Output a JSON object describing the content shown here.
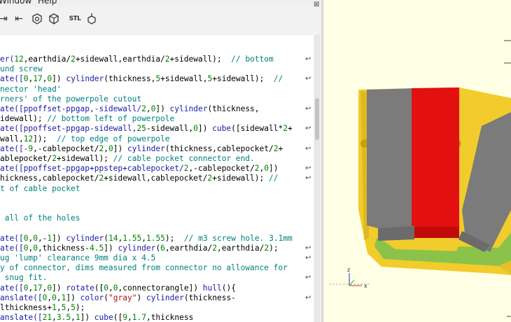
{
  "menu": {
    "window": "Window",
    "help": "Help"
  },
  "toolbar": {
    "stl_label": "STL",
    "close": "⊠"
  },
  "editor": {
    "lines": [
      [
        {
          "t": "er(",
          "c": "kw"
        },
        {
          "t": "12",
          "c": "num"
        },
        {
          "t": ",earthdia/",
          "c": ""
        },
        {
          "t": "2",
          "c": "num"
        },
        {
          "t": "+sidewall,earthdia/",
          "c": ""
        },
        {
          "t": "2",
          "c": "num"
        },
        {
          "t": "+sidewall);  ",
          "c": ""
        },
        {
          "t": "// bottom",
          "c": "cm"
        }
      ],
      [
        {
          "t": "und screw",
          "c": "cm"
        }
      ],
      [
        {
          "t": "ate([",
          "c": "kw"
        },
        {
          "t": "0",
          "c": "num"
        },
        {
          "t": ",",
          "c": ""
        },
        {
          "t": "17",
          "c": "num"
        },
        {
          "t": ",",
          "c": ""
        },
        {
          "t": "0",
          "c": "num"
        },
        {
          "t": "]) ",
          "c": ""
        },
        {
          "t": "cylinder",
          "c": "kw"
        },
        {
          "t": "(thickness,",
          "c": ""
        },
        {
          "t": "5",
          "c": "num"
        },
        {
          "t": "+sidewall,",
          "c": ""
        },
        {
          "t": "5",
          "c": "num"
        },
        {
          "t": "+sidewall);  ",
          "c": ""
        },
        {
          "t": "//",
          "c": "cm"
        }
      ],
      [
        {
          "t": "nector 'head'",
          "c": "cm"
        }
      ],
      [
        {
          "t": "rners' of the powerpole cutout",
          "c": "cm"
        }
      ],
      [
        {
          "t": "ate([ppoffset-ppgap,-sidewall/",
          "c": "kw"
        },
        {
          "t": "2",
          "c": "num"
        },
        {
          "t": ",",
          "c": ""
        },
        {
          "t": "0",
          "c": "num"
        },
        {
          "t": "]) ",
          "c": ""
        },
        {
          "t": "cylinder",
          "c": "kw"
        },
        {
          "t": "(thickness,",
          "c": ""
        }
      ],
      [
        {
          "t": "idewall); ",
          "c": ""
        },
        {
          "t": "// bottom left of powerpole",
          "c": "cm"
        }
      ],
      [
        {
          "t": "ate([ppoffset-ppgap-sidewall,",
          "c": "kw"
        },
        {
          "t": "25",
          "c": "num"
        },
        {
          "t": "-sidewall,",
          "c": ""
        },
        {
          "t": "0",
          "c": "num"
        },
        {
          "t": "]) ",
          "c": ""
        },
        {
          "t": "cube",
          "c": "kw"
        },
        {
          "t": "([sidewall*",
          "c": ""
        },
        {
          "t": "2",
          "c": "num"
        },
        {
          "t": "+",
          "c": ""
        }
      ],
      [
        {
          "t": "wall,",
          "c": ""
        },
        {
          "t": "12",
          "c": "num"
        },
        {
          "t": "]);  ",
          "c": ""
        },
        {
          "t": "// top edge of powerpole",
          "c": "cm"
        }
      ],
      [
        {
          "t": "ate([-",
          "c": "kw"
        },
        {
          "t": "9",
          "c": "num"
        },
        {
          "t": ",-cablepocket/",
          "c": ""
        },
        {
          "t": "2",
          "c": "num"
        },
        {
          "t": ",",
          "c": ""
        },
        {
          "t": "0",
          "c": "num"
        },
        {
          "t": "]) ",
          "c": ""
        },
        {
          "t": "cylinder",
          "c": "kw"
        },
        {
          "t": "(thickness,cablepocket/",
          "c": ""
        },
        {
          "t": "2",
          "c": "num"
        },
        {
          "t": "+",
          "c": ""
        }
      ],
      [
        {
          "t": "ablepocket/",
          "c": ""
        },
        {
          "t": "2",
          "c": "num"
        },
        {
          "t": "+sidewall); ",
          "c": ""
        },
        {
          "t": "// cable pocket connector end.",
          "c": "cm"
        }
      ],
      [
        {
          "t": "ate([ppoffset-ppgap+ppstep+cablepocket/",
          "c": "kw"
        },
        {
          "t": "2",
          "c": "num"
        },
        {
          "t": ",-cablepocket/",
          "c": ""
        },
        {
          "t": "2",
          "c": "num"
        },
        {
          "t": ",",
          "c": ""
        },
        {
          "t": "0",
          "c": "num"
        },
        {
          "t": "])",
          "c": ""
        }
      ],
      [
        {
          "t": "hickness,cablepocket/",
          "c": ""
        },
        {
          "t": "2",
          "c": "num"
        },
        {
          "t": "+sidewall,cablepocket/",
          "c": ""
        },
        {
          "t": "2",
          "c": "num"
        },
        {
          "t": "+sidewall); ",
          "c": ""
        },
        {
          "t": "//",
          "c": "cm"
        }
      ],
      [
        {
          "t": "t of cable pocket",
          "c": "cm"
        }
      ],
      [],
      [],
      [
        {
          "t": " all of the holes",
          "c": "cm"
        }
      ],
      [],
      [
        {
          "t": "ate([",
          "c": "kw"
        },
        {
          "t": "0",
          "c": "num"
        },
        {
          "t": ",",
          "c": ""
        },
        {
          "t": "0",
          "c": "num"
        },
        {
          "t": ",-",
          "c": ""
        },
        {
          "t": "1",
          "c": "num"
        },
        {
          "t": "]) ",
          "c": ""
        },
        {
          "t": "cylinder",
          "c": "kw"
        },
        {
          "t": "(",
          "c": ""
        },
        {
          "t": "14",
          "c": "num"
        },
        {
          "t": ",",
          "c": ""
        },
        {
          "t": "1.55",
          "c": "num"
        },
        {
          "t": ",",
          "c": ""
        },
        {
          "t": "1.55",
          "c": "num"
        },
        {
          "t": ");  ",
          "c": ""
        },
        {
          "t": "// m3 screw hole. 3.1mm",
          "c": "cm"
        }
      ],
      [
        {
          "t": "ate([",
          "c": "kw"
        },
        {
          "t": "0",
          "c": "num"
        },
        {
          "t": ",",
          "c": ""
        },
        {
          "t": "0",
          "c": "num"
        },
        {
          "t": ",thickness-",
          "c": ""
        },
        {
          "t": "4.5",
          "c": "num"
        },
        {
          "t": "]) ",
          "c": ""
        },
        {
          "t": "cylinder",
          "c": "kw"
        },
        {
          "t": "(",
          "c": ""
        },
        {
          "t": "6",
          "c": "num"
        },
        {
          "t": ",earthdia/",
          "c": ""
        },
        {
          "t": "2",
          "c": "num"
        },
        {
          "t": ",earthdia/",
          "c": ""
        },
        {
          "t": "2",
          "c": "num"
        },
        {
          "t": ");",
          "c": ""
        }
      ],
      [
        {
          "t": "ug 'lump' clearance 9mm dia x 4.5",
          "c": "cm"
        }
      ],
      [
        {
          "t": "y of connector, dims measured from connector no allowance for",
          "c": "cm"
        }
      ],
      [
        {
          "t": " snug fit.",
          "c": "cm"
        }
      ],
      [
        {
          "t": "ate([",
          "c": "kw"
        },
        {
          "t": "0",
          "c": "num"
        },
        {
          "t": ",",
          "c": ""
        },
        {
          "t": "17",
          "c": "num"
        },
        {
          "t": ",",
          "c": ""
        },
        {
          "t": "0",
          "c": "num"
        },
        {
          "t": "]) ",
          "c": ""
        },
        {
          "t": "rotate",
          "c": "kw"
        },
        {
          "t": "([",
          "c": ""
        },
        {
          "t": "0",
          "c": "num"
        },
        {
          "t": ",",
          "c": ""
        },
        {
          "t": "0",
          "c": "num"
        },
        {
          "t": ",connectorangle]) ",
          "c": ""
        },
        {
          "t": "hull",
          "c": "kw"
        },
        {
          "t": "(){",
          "c": ""
        }
      ],
      [
        {
          "t": "anslate([",
          "c": "kw"
        },
        {
          "t": "0",
          "c": "num"
        },
        {
          "t": ",",
          "c": ""
        },
        {
          "t": "0",
          "c": "num"
        },
        {
          "t": ",",
          "c": ""
        },
        {
          "t": "1",
          "c": "num"
        },
        {
          "t": "]) ",
          "c": ""
        },
        {
          "t": "color",
          "c": "kw"
        },
        {
          "t": "(",
          "c": ""
        },
        {
          "t": "\"gray\"",
          "c": "str"
        },
        {
          "t": ") ",
          "c": ""
        },
        {
          "t": "cylinder",
          "c": "kw"
        },
        {
          "t": "(thickness-",
          "c": ""
        }
      ],
      [
        {
          "t": "lthickness+",
          "c": ""
        },
        {
          "t": "1",
          "c": "num"
        },
        {
          "t": ",",
          "c": ""
        },
        {
          "t": "5",
          "c": "num"
        },
        {
          "t": ",",
          "c": ""
        },
        {
          "t": "5",
          "c": "num"
        },
        {
          "t": ");",
          "c": ""
        }
      ],
      [
        {
          "t": "anslate([",
          "c": "kw"
        },
        {
          "t": "21",
          "c": "num"
        },
        {
          "t": ",",
          "c": ""
        },
        {
          "t": "3.5",
          "c": "num"
        },
        {
          "t": ",",
          "c": ""
        },
        {
          "t": "1",
          "c": "num"
        },
        {
          "t": "]) ",
          "c": ""
        },
        {
          "t": "cube",
          "c": "kw"
        },
        {
          "t": "([",
          "c": ""
        },
        {
          "t": "9",
          "c": "num"
        },
        {
          "t": ",",
          "c": ""
        },
        {
          "t": "1.7",
          "c": "num"
        },
        {
          "t": ",thickness",
          "c": ""
        }
      ]
    ],
    "wrap_symbol": "↩",
    "wrapped_lines": [
      0,
      2,
      5,
      7,
      9,
      11,
      12,
      19,
      20,
      22,
      24
    ]
  },
  "colors": {
    "part_yellow": "#f2cc2c",
    "part_gray": "#7b7b7b",
    "part_red": "#e31010",
    "part_green": "#8bc34a",
    "background": "#ffffe5"
  },
  "viewport": {
    "axis_x": "x",
    "axis_z": "z"
  }
}
